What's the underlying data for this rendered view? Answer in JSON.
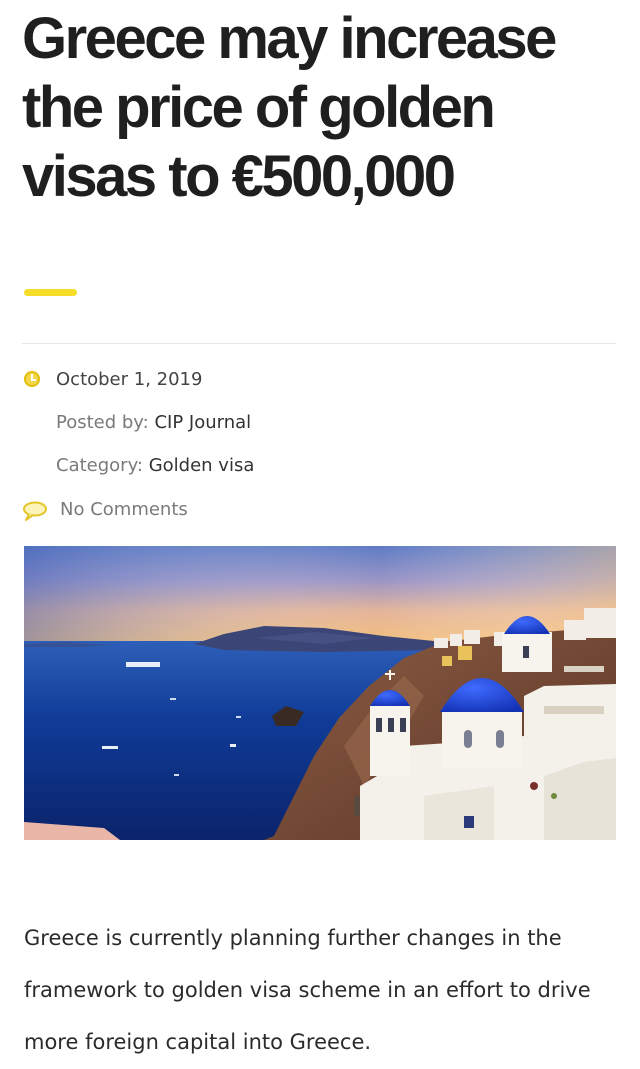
{
  "article": {
    "title": "Greece may increase the price of golden visas to €500,000",
    "date": "October 1, 2019",
    "posted_by_label": "Posted by:",
    "posted_by_value": "CIP Journal",
    "category_label": "Category:",
    "category_value": "Golden visa",
    "comments": "No Comments",
    "body": "Greece is currently planning further changes in the framework to golden visa scheme in an effort to drive more foreign capital into Greece."
  },
  "icons": {
    "date": "clock-icon",
    "comments": "comment-bubble-icon"
  },
  "colors": {
    "accent": "#f5dd2a",
    "title": "#1f1f1f",
    "meta_label": "#7a7a7a",
    "dome_blue": "#1d3fd1",
    "sea_blue": "#0d2a7a"
  }
}
